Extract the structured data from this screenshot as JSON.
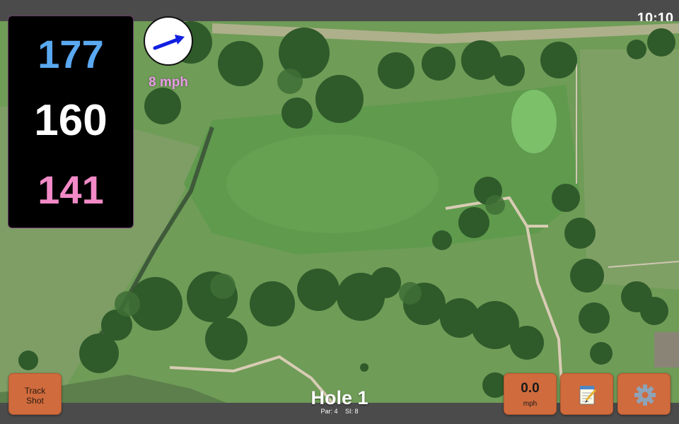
{
  "status": {
    "clock": "10:10"
  },
  "distances": {
    "back": "177",
    "middle": "160",
    "front": "141",
    "colors": {
      "back": "#5aa8f0",
      "middle": "#ffffff",
      "front": "#f28ac7"
    }
  },
  "wind": {
    "speed_label": "8 mph",
    "arrow_icon": "wind-direction-arrow-icon",
    "arrow_color": "#1020e0"
  },
  "buttons": {
    "track_shot": [
      "Track",
      "Shot"
    ],
    "speed_value": "0.0",
    "speed_unit": "mph",
    "notes_icon": "notepad-icon",
    "settings_icon": "gear-icon",
    "accent": "#cf6b3d"
  },
  "hole": {
    "title": "Hole 1",
    "par": "Par: 4",
    "si": "SI: 8"
  }
}
